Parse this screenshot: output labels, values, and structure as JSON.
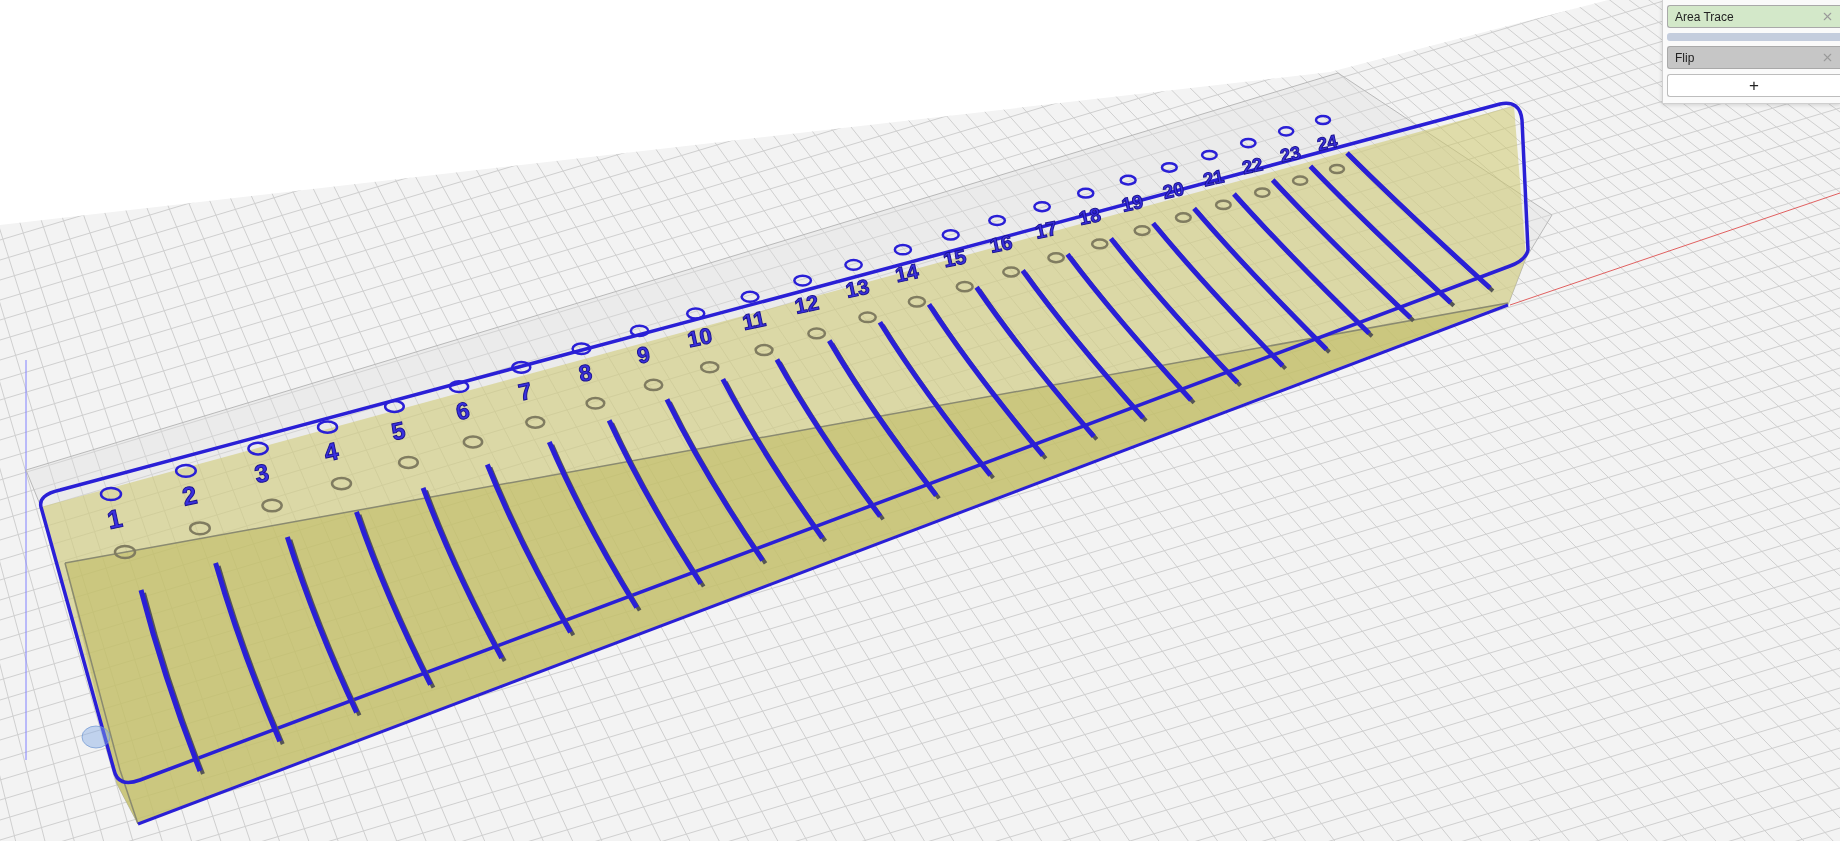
{
  "viewport": {
    "slot_labels": [
      "1",
      "2",
      "3",
      "4",
      "5",
      "6",
      "7",
      "8",
      "9",
      "10",
      "11",
      "12",
      "13",
      "14",
      "15",
      "16",
      "17",
      "18",
      "19",
      "20",
      "21",
      "22",
      "23",
      "24"
    ]
  },
  "operations_panel": {
    "items": [
      {
        "label": "Area Trace",
        "color": "#d3e8c9"
      },
      {
        "label": "Flip",
        "color": "#c6c6c6"
      }
    ],
    "add_button": "+"
  }
}
